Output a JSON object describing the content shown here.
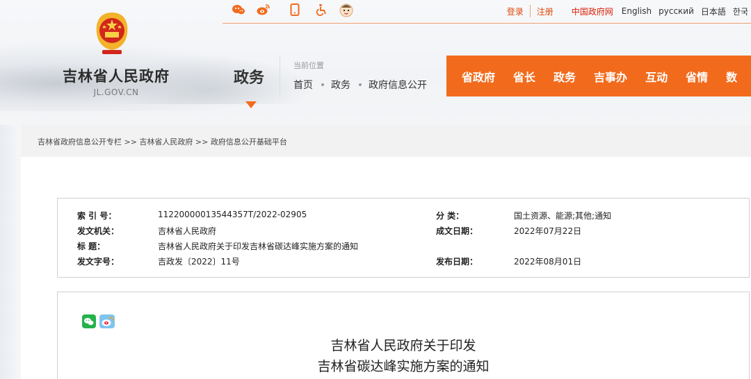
{
  "header": {
    "top_links": {
      "login": "登录",
      "register": "注册",
      "china_gov": "中国政府网",
      "languages": [
        "English",
        "русский",
        "日本語",
        "한국"
      ]
    },
    "social_icons": [
      "weibo-style-icon",
      "weibo-icon",
      "mobile-icon",
      "accessibility-icon",
      "mascot-icon"
    ],
    "site_name": "吉林省人民政府",
    "site_domain": "JL.GOV.CN",
    "section_title": "政务",
    "location_label": "当前位置",
    "location_crumbs": [
      "首页",
      "政务",
      "政府信息公开"
    ],
    "nav_items": [
      "省政府",
      "省长",
      "政务",
      "吉事办",
      "互动",
      "省情",
      "数"
    ]
  },
  "breadcrumb": "吉林省政府信息公开专栏 >> 吉林省人民政府 >> 政府信息公开基础平台",
  "info": {
    "index_label": "索 引 号：",
    "index_value": "11220000013544357T/2022-02905",
    "category_label": "分 类：",
    "category_value": "国土资源、能源;其他;通知",
    "issuer_label": "发文机关：",
    "issuer_value": "吉林省人民政府",
    "written_date_label": "成文日期：",
    "written_date_value": "2022年07月22日",
    "title_label": "标 题：",
    "title_value": "吉林省人民政府关于印发吉林省碳达峰实施方案的通知",
    "doc_no_label": "发文字号：",
    "doc_no_value": "吉政发〔2022〕11号",
    "publish_date_label": "发布日期：",
    "publish_date_value": "2022年08月01日"
  },
  "document": {
    "title_line1": "吉林省人民政府关于印发",
    "title_line2": "吉林省碳达峰实施方案的通知"
  },
  "colors": {
    "accent": "#f26b1d",
    "link_red": "#d81e06"
  }
}
